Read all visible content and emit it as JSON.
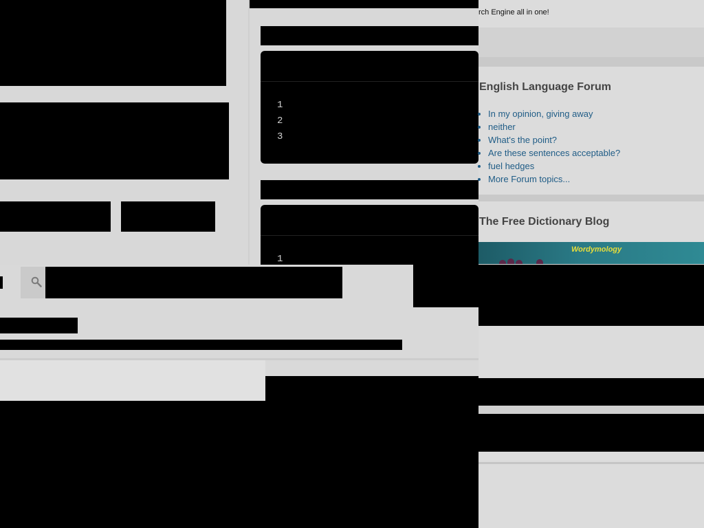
{
  "header": {
    "tagline": "rch Engine all in one!"
  },
  "code_blocks": [
    {
      "line_numbers": [
        "1",
        "2",
        "3"
      ]
    },
    {
      "line_numbers": [
        "1"
      ]
    }
  ],
  "sidebar": {
    "forum": {
      "title": "English Language Forum",
      "items": [
        "In my opinion, giving away",
        "neither",
        "What's the point?",
        "Are these sentences acceptable?",
        "fuel hedges",
        "More Forum topics..."
      ]
    },
    "blog": {
      "title": "The Free Dictionary Blog",
      "image_label": "Wordymology"
    }
  },
  "search": {
    "icon": "search-icon"
  },
  "colors": {
    "link": "#1f5c86",
    "title": "#444444",
    "redaction": "#000000",
    "blog_label": "#e9de3a"
  }
}
